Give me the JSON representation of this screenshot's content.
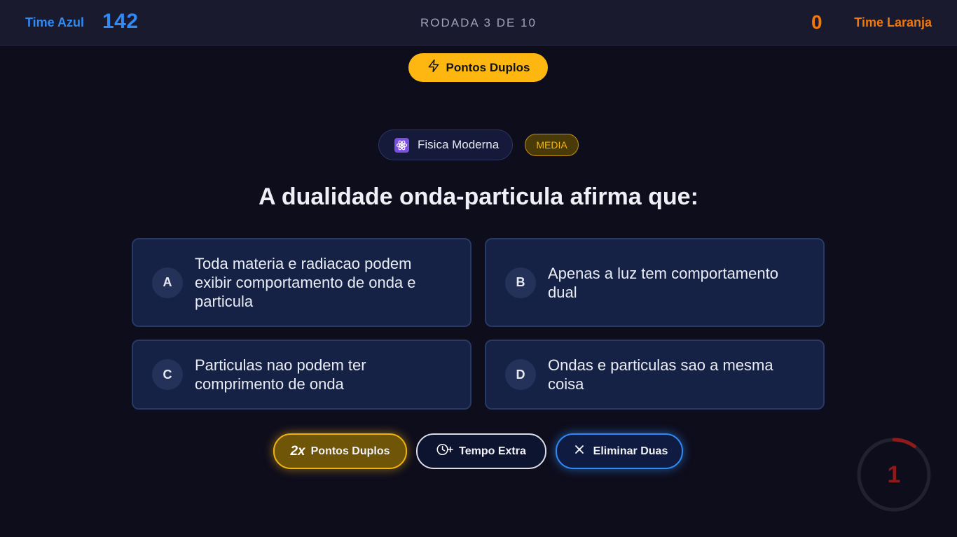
{
  "header": {
    "team_left": {
      "name": "Time Azul",
      "score": "142",
      "color": "#2f8af5"
    },
    "round": "RODADA 3 DE 10",
    "team_right": {
      "name": "Time Laranja",
      "score": "0",
      "color": "#f0780f"
    }
  },
  "banner": {
    "label": "Pontos Duplos",
    "icon": "lightning-icon"
  },
  "question": {
    "category": {
      "label": "Fisica Moderna",
      "icon": "atom-icon"
    },
    "difficulty": "MEDIA",
    "text": "A dualidade onda-particula afirma que:"
  },
  "answers": [
    {
      "letter": "A",
      "text": "Toda materia e radiacao podem exibir comportamento de onda e particula"
    },
    {
      "letter": "B",
      "text": "Apenas a luz tem comportamento dual"
    },
    {
      "letter": "C",
      "text": "Particulas nao podem ter comprimento de onda"
    },
    {
      "letter": "D",
      "text": "Ondas e particulas sao a mesma coisa"
    }
  ],
  "powerups": [
    {
      "prefix": "2x",
      "label": "Pontos Duplos",
      "color": "#f0b20f"
    },
    {
      "icon": "clock-plus-icon",
      "label": "Tempo Extra",
      "color": "#d9dbe5"
    },
    {
      "icon": "close-icon",
      "label": "Eliminar Duas",
      "color": "#2f8af5"
    }
  ],
  "timer": {
    "seconds": "1",
    "remaining_fraction": 0.1,
    "color": "#8f1a1a"
  }
}
